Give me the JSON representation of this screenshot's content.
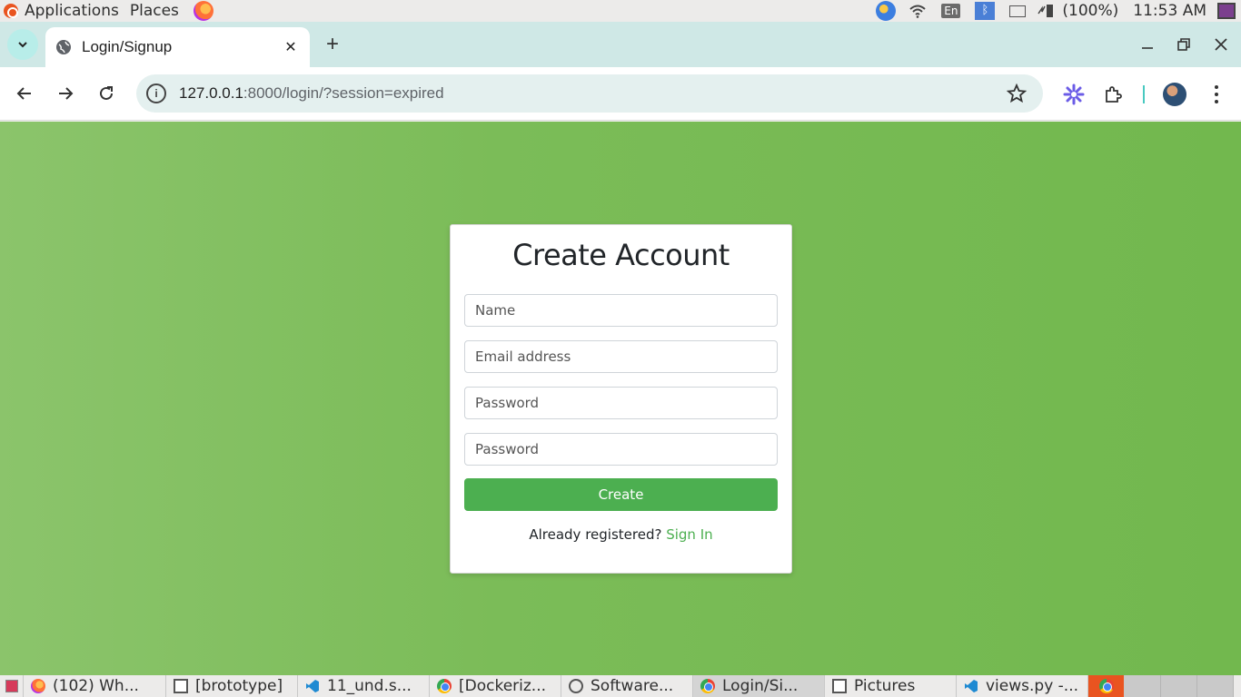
{
  "system_panel": {
    "applications_label": "Applications",
    "places_label": "Places",
    "keyboard_layout": "En",
    "battery_percent": "(100%)",
    "clock": "11:53 AM"
  },
  "browser": {
    "tab_title": "Login/Signup",
    "url_host": "127.0.0.1",
    "url_rest": ":8000/login/?session=expired"
  },
  "form": {
    "title": "Create Account",
    "name_placeholder": "Name",
    "email_placeholder": "Email address",
    "password_placeholder": "Password",
    "confirm_password_placeholder": "Password",
    "submit_label": "Create",
    "already_registered_text": "Already registered?",
    "sign_in_link": "Sign In"
  },
  "taskbar": {
    "tasks": [
      {
        "label": "(102) Wh...",
        "icon": "firefox-icon"
      },
      {
        "label": "[brototype]",
        "icon": "terminal-icon"
      },
      {
        "label": "11_und.s...",
        "icon": "vscode-icon"
      },
      {
        "label": "[Dockeriz...",
        "icon": "chrome-icon"
      },
      {
        "label": "Software...",
        "icon": "software-icon"
      },
      {
        "label": "Login/Si...",
        "icon": "chrome-icon"
      },
      {
        "label": "Pictures",
        "icon": "folder-icon"
      },
      {
        "label": "views.py -...",
        "icon": "vscode-icon"
      }
    ]
  },
  "colors": {
    "page_background": "#7bbc58",
    "accent_green": "#4caf50",
    "tab_strip": "#cfe8e6"
  }
}
